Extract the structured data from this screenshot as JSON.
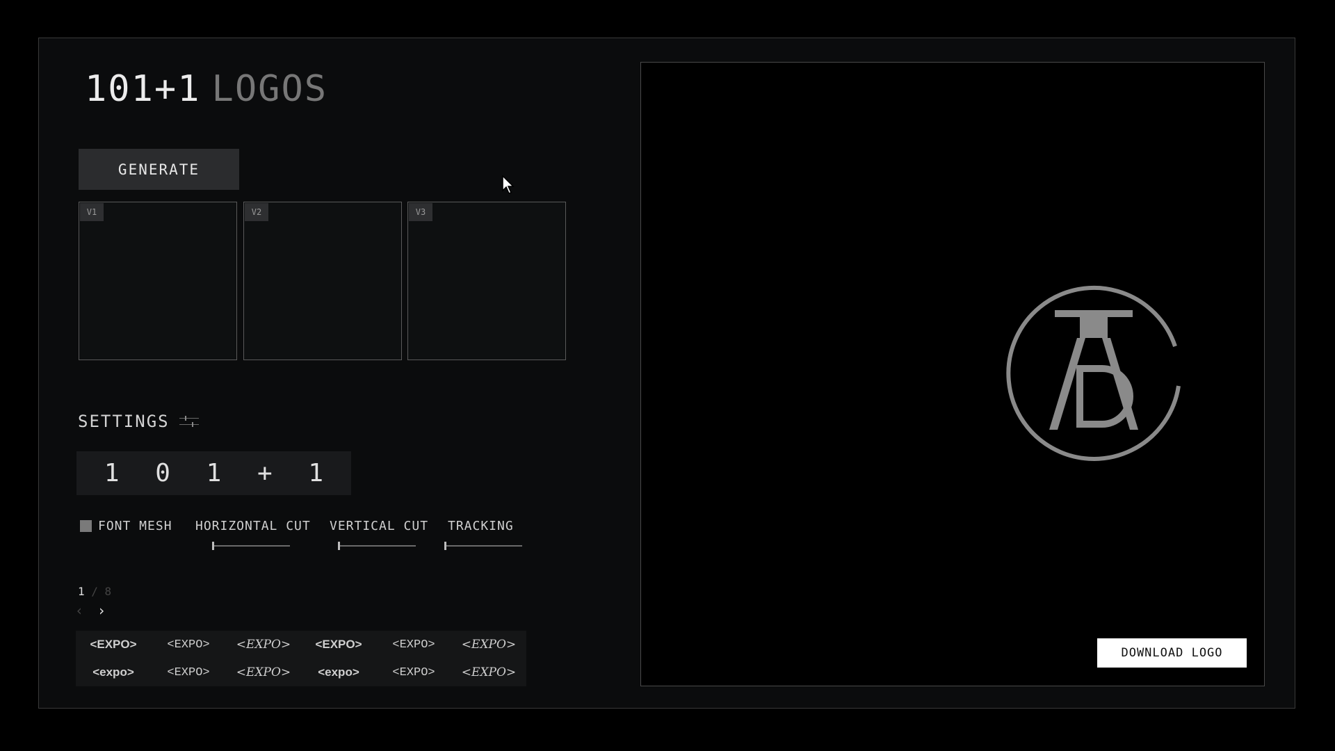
{
  "brand": {
    "number": "101+1",
    "word": "LOGOS"
  },
  "generate_label": "GENERATE",
  "variants": [
    {
      "tag": "V1"
    },
    {
      "tag": "V2"
    },
    {
      "tag": "V3"
    }
  ],
  "settings": {
    "title": "SETTINGS",
    "icon": "sliders-icon",
    "characters": [
      "1",
      "0",
      "1",
      "+",
      "1"
    ],
    "font_mesh": {
      "label": "FONT MESH",
      "checked": true
    },
    "sliders": [
      {
        "label": "HORIZONTAL CUT",
        "value": 0
      },
      {
        "label": "VERTICAL CUT",
        "value": 0
      },
      {
        "label": "TRACKING",
        "value": 0
      }
    ]
  },
  "pager": {
    "current": "1",
    "separator": " / ",
    "total": "8",
    "prev_icon": "chevron-left-icon",
    "next_icon": "chevron-right-icon"
  },
  "font_samples": [
    "<EXPO>",
    "<EXPO>",
    "<EXPO>",
    "<EXPO>",
    "<EXPO>",
    "<EXPO>",
    "<expo>",
    "<EXPO>",
    "<EXPO>",
    "<expo>",
    "<EXPO>",
    "<EXPO>"
  ],
  "preview": {
    "logo_letters": "A D C",
    "logo_color": "#8a8a8a",
    "download_label": "DOWNLOAD LOGO"
  },
  "colors": {
    "background": "#000000",
    "panel": "#0b0c0d",
    "accent": "#ffffff"
  }
}
